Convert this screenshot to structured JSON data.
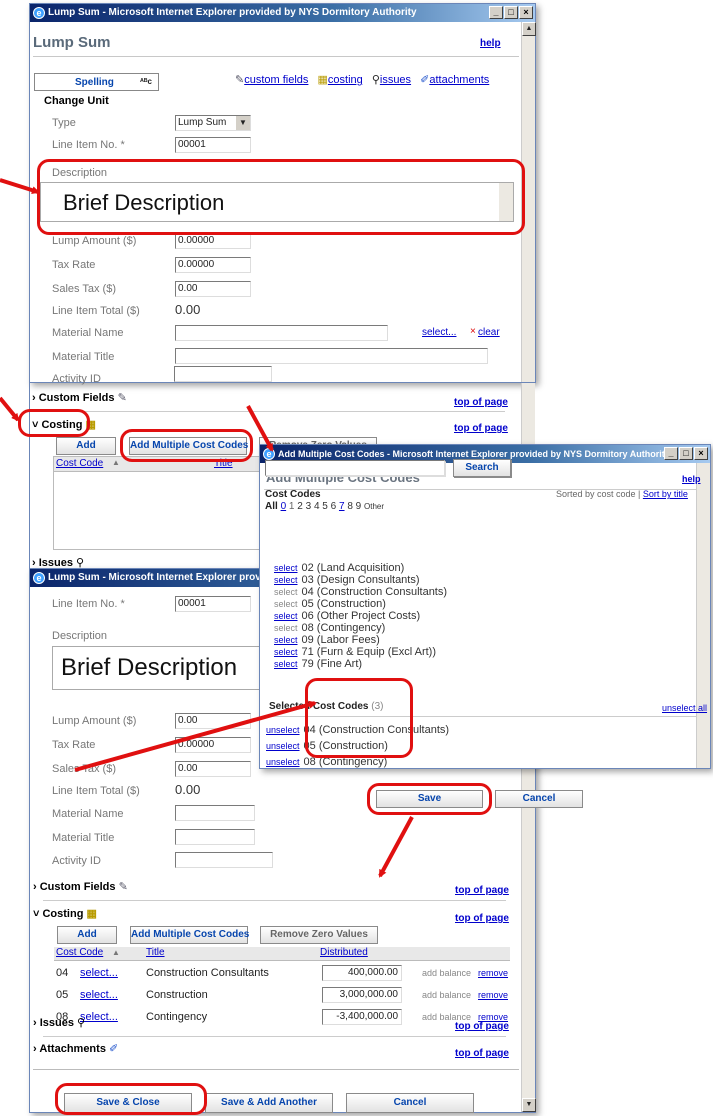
{
  "main_window": {
    "title": "Lump Sum - Microsoft Internet Explorer provided by NYS Dormitory Authority",
    "heading": "Lump Sum",
    "help": "help",
    "spelling": "Spelling",
    "spell_glyph": "ᴬᴮc",
    "top_links": [
      "custom fields",
      "costing",
      "issues",
      "attachments"
    ],
    "group_title": "Change Unit",
    "fields": {
      "type_label": "Type",
      "type_value": "Lump Sum",
      "line_item_label": "Line Item No. *",
      "line_item_value": "00001",
      "description_label": "Description",
      "description_value": "Brief Description",
      "lump_amount_label": "Lump Amount ($)",
      "lump_amount_value": "0.00000",
      "tax_rate_label": "Tax Rate",
      "tax_rate_value": "0.00000",
      "sales_tax_label": "Sales Tax ($)",
      "sales_tax_value": "0.00",
      "line_total_label": "Line Item Total ($)",
      "line_total_value": "0.00",
      "material_name_label": "Material Name",
      "material_title_label": "Material Title",
      "activity_id_label": "Activity ID",
      "select": "select...",
      "clear": "clear"
    },
    "sections": {
      "custom_fields": "Custom Fields",
      "costing": "Costing",
      "issues": "Issues",
      "top_of_page": "top of page"
    },
    "costing_buttons": [
      "Add",
      "Add Multiple Cost Codes",
      "Remove Zero Values"
    ],
    "table_headers": [
      "Cost Code",
      "Title"
    ]
  },
  "second_window": {
    "title": "Lump Sum - Microsoft Internet Explorer provided b",
    "line_item_label": "Line Item No. *",
    "line_item_value": "00001",
    "description_label": "Description",
    "description_value": "Brief Description",
    "lump_amount_label": "Lump Amount ($)",
    "lump_amount_value": "0.00",
    "tax_rate_label": "Tax Rate",
    "tax_rate_value": "0.00000",
    "sales_tax_label": "Sales Tax ($)",
    "sales_tax_value": "0.00",
    "line_total_label": "Line Item Total ($)",
    "line_total_value": "0.00",
    "material_name_label": "Material Name",
    "material_title_label": "Material Title",
    "activity_id_label": "Activity ID",
    "sections": {
      "custom_fields": "Custom Fields",
      "costing": "Costing",
      "issues": "Issues",
      "attachments": "Attachments",
      "top_of_page": "top of page"
    },
    "costing_buttons": [
      "Add",
      "Add Multiple Cost Codes",
      "Remove Zero Values"
    ],
    "table_headers": [
      "Cost Code",
      "Title",
      "Distributed"
    ],
    "rows": [
      {
        "code": "04",
        "select": "select...",
        "title": "Construction Consultants",
        "amount": "400,000.00",
        "add_balance": "add balance",
        "remove": "remove"
      },
      {
        "code": "05",
        "select": "select...",
        "title": "Construction",
        "amount": "3,000,000.00",
        "add_balance": "add balance",
        "remove": "remove"
      },
      {
        "code": "08",
        "select": "select...",
        "title": "Contingency",
        "amount": "-3,400,000.00",
        "add_balance": "add balance",
        "remove": "remove"
      }
    ],
    "footer_buttons": [
      "Save & Close",
      "Save & Add Another",
      "Cancel"
    ]
  },
  "popup": {
    "title": "Add Multiple Cost Codes - Microsoft Internet Explorer provided by NYS Dormitory Authority",
    "heading": "Add Multiple Cost Codes",
    "help": "help",
    "search_button": "Search",
    "cost_codes_label": "Cost Codes",
    "sorted_by": "Sorted by cost code",
    "sort_by_title": "Sort by title",
    "filter_all": "All",
    "filter_digits": [
      "0",
      "1",
      "2",
      "3",
      "4",
      "5",
      "6",
      "7",
      "8",
      "9"
    ],
    "filter_other": "Other",
    "codes": [
      {
        "action": "select",
        "label": "02 (Land Acquisition)",
        "enabled": true
      },
      {
        "action": "select",
        "label": "03 (Design Consultants)",
        "enabled": true
      },
      {
        "action": "select",
        "label": "04 (Construction Consultants)",
        "enabled": false
      },
      {
        "action": "select",
        "label": "05 (Construction)",
        "enabled": false
      },
      {
        "action": "select",
        "label": "06 (Other Project Costs)",
        "enabled": true
      },
      {
        "action": "select",
        "label": "08 (Contingency)",
        "enabled": false
      },
      {
        "action": "select",
        "label": "09 (Labor Fees)",
        "enabled": true
      },
      {
        "action": "select",
        "label": "71 (Furn & Equip (Excl Art))",
        "enabled": true
      },
      {
        "action": "select",
        "label": "79 (Fine Art)",
        "enabled": true
      }
    ],
    "selected_label": "Selected Cost Codes",
    "selected_count": "(3)",
    "unselect_all": "unselect all",
    "selected": [
      {
        "action": "unselect",
        "label": "04 (Construction Consultants)"
      },
      {
        "action": "unselect",
        "label": "05 (Construction)"
      },
      {
        "action": "unselect",
        "label": "08 (Contingency)"
      }
    ],
    "save": "Save",
    "cancel": "Cancel"
  },
  "colors": {
    "accent": "#e01010",
    "link": "#0000cc",
    "title_bar": "#0a246a"
  }
}
